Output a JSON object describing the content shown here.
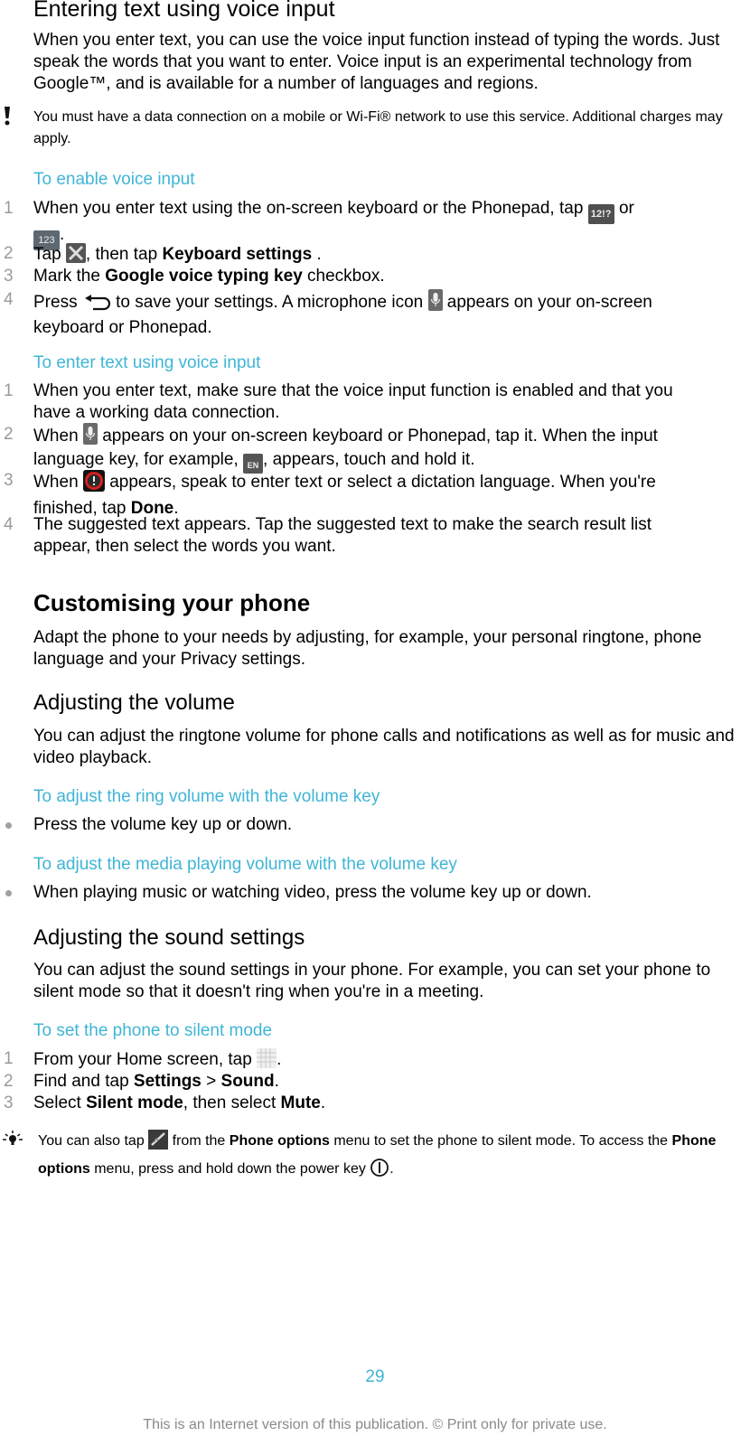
{
  "section1": {
    "title": "Entering text using voice input",
    "intro": "When you enter text, you can use the voice input function instead of typing the words. Just speak the words that you want to enter. Voice input is an experimental technology from Google™, and is available for a number of languages and regions.",
    "note": "You must have a data connection on a mobile or Wi-Fi® network to use this service. Additional charges may apply."
  },
  "enable": {
    "title": "To enable voice input",
    "s1a": "When you enter text using the on-screen keyboard or the Phonepad, tap",
    "s1b": "or",
    "icon_12": "12!?",
    "icon_123": "123",
    "s2a": "Tap",
    "s2b": ", then tap",
    "s2c": "Keyboard settings",
    "s2d": " .",
    "s3a": "Mark the",
    "s3b": "Google voice typing key",
    "s3c": "checkbox.",
    "s4a": "Press",
    "s4b": "to save your settings. A microphone icon",
    "s4c": "appears on your on-screen keyboard or Phonepad."
  },
  "enter": {
    "title": "To enter text using voice input",
    "s1": "When you enter text, make sure that the voice input function is enabled and that you have a working data connection.",
    "s2a": "When",
    "s2b": "appears on your on-screen keyboard or Phonepad, tap it. When the input language key, for example,",
    "s2c": ", appears, touch and hold it.",
    "icon_en": "EN",
    "s3a": "When",
    "s3b": "appears, speak to enter text or select a dictation language. When you're finished, tap",
    "s3c": "Done",
    "s3d": ".",
    "s4": "The suggested text appears. Tap the suggested text to make the search result list appear, then select the words you want."
  },
  "customise": {
    "title": "Customising your phone",
    "intro": "Adapt the phone to your needs by adjusting, for example, your personal ringtone, phone language and your Privacy settings."
  },
  "volume": {
    "title": "Adjusting the volume",
    "intro": "You can adjust the ringtone volume for phone calls and notifications as well as for music and video playback.",
    "ring_title": "To adjust the ring volume with the volume key",
    "ring_step": "Press the volume key up or down.",
    "media_title": "To adjust the media playing volume with the volume key",
    "media_step": "When playing music or watching video, press the volume key up or down."
  },
  "sound": {
    "title": "Adjusting the sound settings",
    "intro": "You can adjust the sound settings in your phone. For example, you can set your phone to silent mode so that it doesn't ring when you're in a meeting.",
    "silent_title": "To set the phone to silent mode",
    "s1": "From your Home screen, tap",
    "s1end": ".",
    "s2a": "Find and tap",
    "s2b": "Settings",
    "s2c": " > ",
    "s2d": "Sound",
    "s2e": ".",
    "s3a": "Select",
    "s3b": "Silent mode",
    "s3c": ", then select",
    "s3d": "Mute",
    "s3e": ".",
    "tip_a": "You can also tap",
    "tip_b": "from the",
    "tip_c": "Phone options",
    "tip_d": "menu to set the phone to silent mode. To access the",
    "tip_e": "Phone options",
    "tip_f": "menu, press and hold down the power key",
    "tip_g": "."
  },
  "numbers": [
    "1",
    "2",
    "3",
    "4"
  ],
  "footer": {
    "page": "29",
    "notice": "This is an Internet version of this publication. © Print only for private use."
  }
}
